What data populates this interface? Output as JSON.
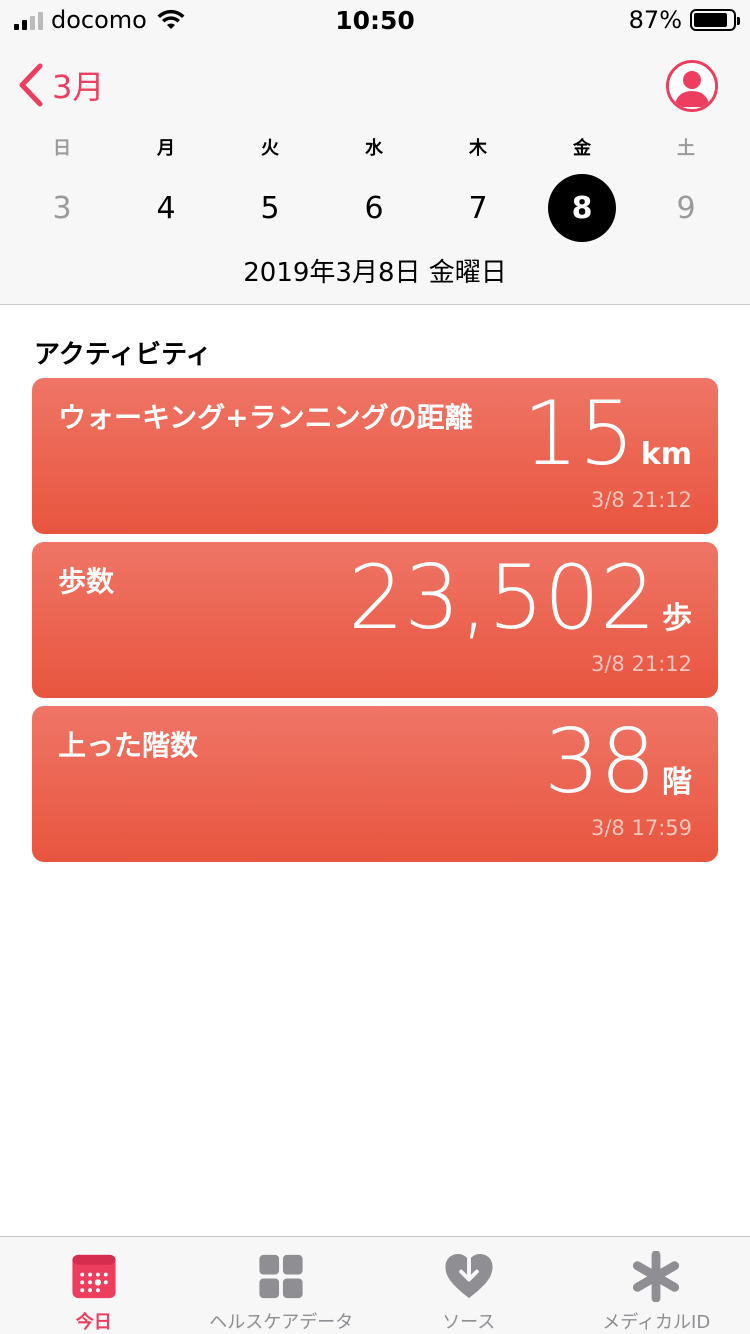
{
  "status": {
    "carrier": "docomo",
    "time": "10:50",
    "battery": "87%"
  },
  "header": {
    "back_label": "3月"
  },
  "week": {
    "days": [
      "日",
      "月",
      "火",
      "水",
      "木",
      "金",
      "土"
    ],
    "dates": [
      "3",
      "4",
      "5",
      "6",
      "7",
      "8",
      "9"
    ],
    "selected_index": 5,
    "full_date": "2019年3月8日 金曜日"
  },
  "activity": {
    "title": "アクティビティ",
    "cards": [
      {
        "title": "ウォーキング+ランニングの距離",
        "value": "15",
        "unit": "km",
        "time": "3/8 21:12"
      },
      {
        "title": "歩数",
        "value": "23,502",
        "unit": "歩",
        "time": "3/8 21:12"
      },
      {
        "title": "上った階数",
        "value": "38",
        "unit": "階",
        "time": "3/8 17:59"
      }
    ]
  },
  "tabs": [
    {
      "label": "今日",
      "icon": "calendar-icon",
      "active": true
    },
    {
      "label": "ヘルスケアデータ",
      "icon": "grid-icon",
      "active": false
    },
    {
      "label": "ソース",
      "icon": "heart-download-icon",
      "active": false
    },
    {
      "label": "メディカルID",
      "icon": "asterisk-icon",
      "active": false
    }
  ],
  "colors": {
    "accent": "#ee3e5f",
    "card_top": "#ef7566",
    "card_bottom": "#e8553f"
  }
}
